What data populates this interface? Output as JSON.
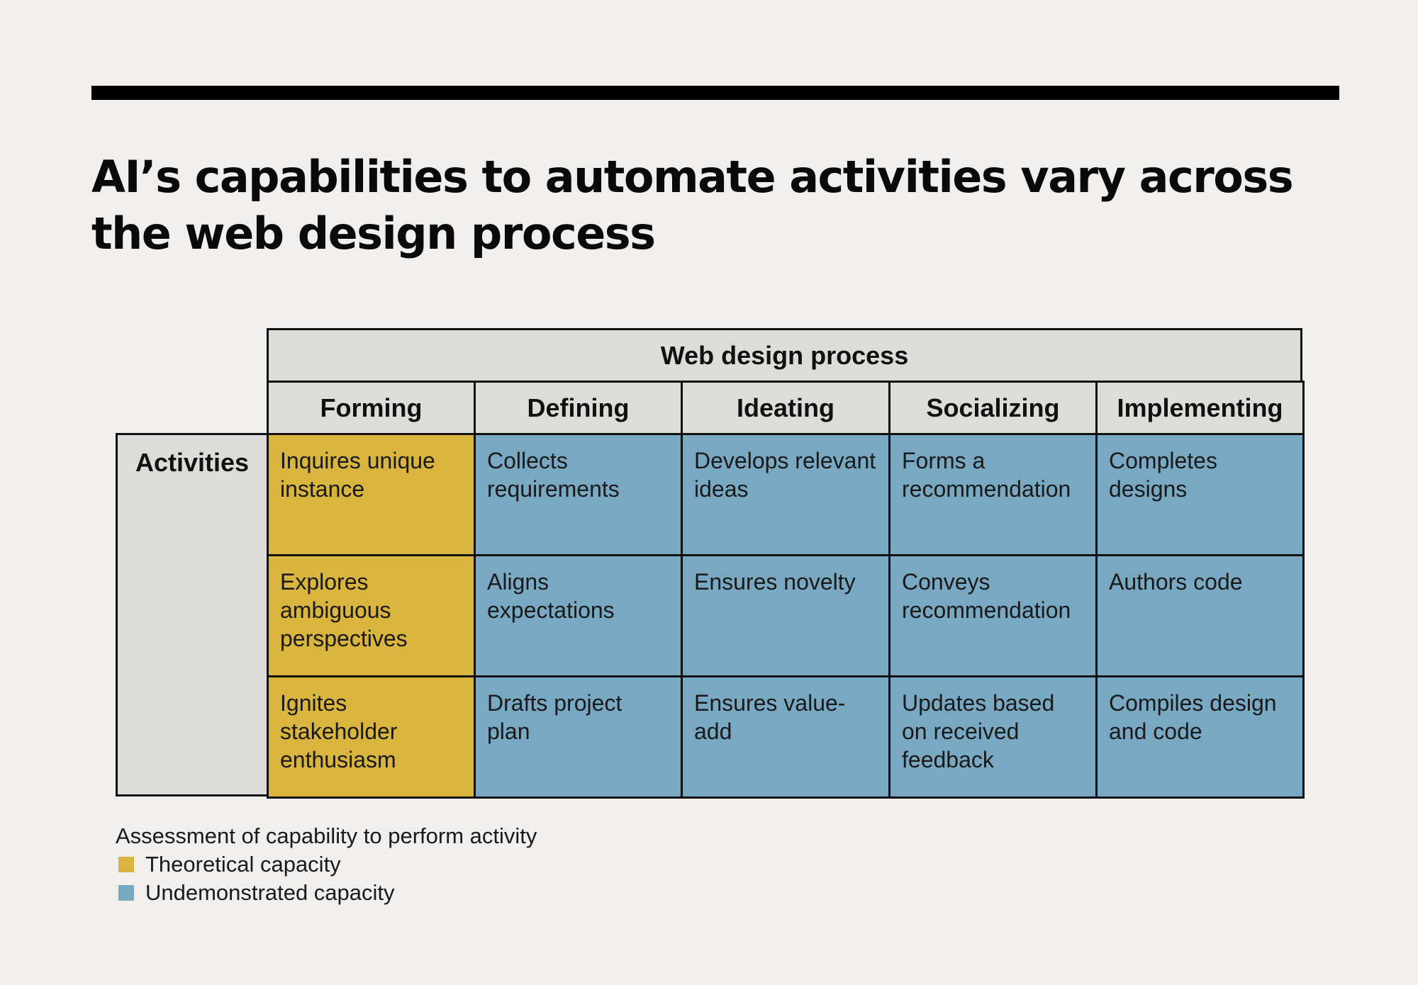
{
  "title": "AI’s capabilities to automate activities vary across the web design process",
  "colors": {
    "theoretical": "#d9b43e",
    "undemonstrated": "#78a8c2",
    "header": "#dcddd8",
    "background": "#f0efed"
  },
  "table": {
    "group_header": "Web design process",
    "row_header": "Activities",
    "columns": [
      "Forming",
      "Defining",
      "Ideating",
      "Socializing",
      "Implementing"
    ],
    "rows": [
      [
        {
          "text": "Inquires unique instance",
          "assessment": "Theoretical capacity"
        },
        {
          "text": "Collects requirements",
          "assessment": "Undemonstrated capacity"
        },
        {
          "text": "Develops relevant ideas",
          "assessment": "Undemonstrated capacity"
        },
        {
          "text": "Forms a recommendation",
          "assessment": "Undemonstrated capacity"
        },
        {
          "text": "Completes designs",
          "assessment": "Undemonstrated capacity"
        }
      ],
      [
        {
          "text": "Explores ambiguous perspectives",
          "assessment": "Theoretical capacity"
        },
        {
          "text": "Aligns expectations",
          "assessment": "Undemonstrated capacity"
        },
        {
          "text": "Ensures novelty",
          "assessment": "Undemonstrated capacity"
        },
        {
          "text": "Conveys recommendation",
          "assessment": "Undemonstrated capacity"
        },
        {
          "text": "Authors code",
          "assessment": "Undemonstrated capacity"
        }
      ],
      [
        {
          "text": "Ignites stakeholder enthusiasm",
          "assessment": "Theoretical capacity"
        },
        {
          "text": "Drafts project plan",
          "assessment": "Undemonstrated capacity"
        },
        {
          "text": "Ensures value-add",
          "assessment": "Undemonstrated capacity"
        },
        {
          "text": "Updates based on received feedback",
          "assessment": "Undemonstrated capacity"
        },
        {
          "text": "Compiles design and code",
          "assessment": "Undemonstrated capacity"
        }
      ]
    ]
  },
  "legend": {
    "title": "Assessment of capability to perform activity",
    "items": [
      {
        "label": "Theoretical capacity",
        "color": "#d9b43e"
      },
      {
        "label": "Undemonstrated capacity",
        "color": "#78a8c2"
      }
    ]
  }
}
